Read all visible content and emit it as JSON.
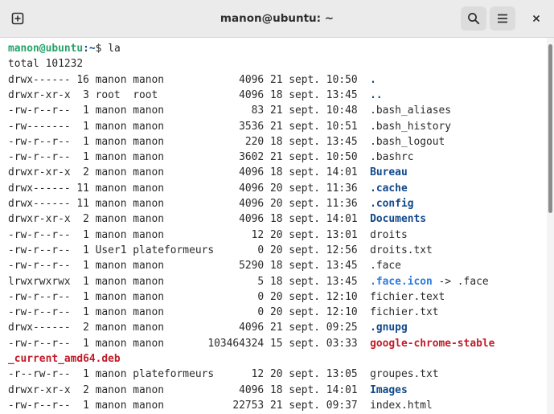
{
  "window": {
    "title": "manon@ubuntu: ~"
  },
  "toolbar": {
    "new_tab_icon": "new-tab-icon",
    "search_icon": "search-icon",
    "menu_icon": "hamburger-menu-icon",
    "close_icon": "close-icon"
  },
  "prompt": {
    "user_host": "manon@ubuntu",
    "path": ":~",
    "command": "$ la"
  },
  "output": {
    "total": "total 101232",
    "rows": [
      {
        "meta": "drwx------ 16 manon manon            4096 21 sept. 10:50  ",
        "name": ".",
        "kind": "dir",
        "suffix": ""
      },
      {
        "meta": "drwxr-xr-x  3 root  root             4096 18 sept. 13:45  ",
        "name": "..",
        "kind": "dir",
        "suffix": ""
      },
      {
        "meta": "-rw-r--r--  1 manon manon              83 21 sept. 10:48  ",
        "name": ".bash_aliases",
        "kind": "file",
        "suffix": ""
      },
      {
        "meta": "-rw-------  1 manon manon            3536 21 sept. 10:51  ",
        "name": ".bash_history",
        "kind": "file",
        "suffix": ""
      },
      {
        "meta": "-rw-r--r--  1 manon manon             220 18 sept. 13:45  ",
        "name": ".bash_logout",
        "kind": "file",
        "suffix": ""
      },
      {
        "meta": "-rw-r--r--  1 manon manon            3602 21 sept. 10:50  ",
        "name": ".bashrc",
        "kind": "file",
        "suffix": ""
      },
      {
        "meta": "drwxr-xr-x  2 manon manon            4096 18 sept. 14:01  ",
        "name": "Bureau",
        "kind": "dir",
        "suffix": ""
      },
      {
        "meta": "drwx------ 11 manon manon            4096 20 sept. 11:36  ",
        "name": ".cache",
        "kind": "dir",
        "suffix": ""
      },
      {
        "meta": "drwx------ 11 manon manon            4096 20 sept. 11:36  ",
        "name": ".config",
        "kind": "dir",
        "suffix": ""
      },
      {
        "meta": "drwxr-xr-x  2 manon manon            4096 18 sept. 14:01  ",
        "name": "Documents",
        "kind": "dir",
        "suffix": ""
      },
      {
        "meta": "-rw-r--r--  1 manon manon              12 20 sept. 13:01  ",
        "name": "droits",
        "kind": "file",
        "suffix": ""
      },
      {
        "meta": "-rw-r--r--  1 User1 plateformeurs       0 20 sept. 12:56  ",
        "name": "droits.txt",
        "kind": "file",
        "suffix": ""
      },
      {
        "meta": "-rw-r--r--  1 manon manon            5290 18 sept. 13:45  ",
        "name": ".face",
        "kind": "file",
        "suffix": ""
      },
      {
        "meta": "lrwxrwxrwx  1 manon manon               5 18 sept. 13:45  ",
        "name": ".face.icon",
        "kind": "link",
        "suffix": " -> .face"
      },
      {
        "meta": "-rw-r--r--  1 manon manon               0 20 sept. 12:10  ",
        "name": "fichier.text",
        "kind": "file",
        "suffix": ""
      },
      {
        "meta": "-rw-r--r--  1 manon manon               0 20 sept. 12:10  ",
        "name": "fichier.txt",
        "kind": "file",
        "suffix": ""
      },
      {
        "meta": "drwx------  2 manon manon            4096 21 sept. 09:25  ",
        "name": ".gnupg",
        "kind": "dir",
        "suffix": ""
      },
      {
        "meta": "-rw-r--r--  1 manon manon       103464324 15 sept. 03:33  ",
        "name": "google-chrome-stable",
        "kind": "pkg",
        "suffix": ""
      },
      {
        "meta": "",
        "name": "_current_amd64.deb",
        "kind": "pkg",
        "suffix": ""
      },
      {
        "meta": "-r--rw-r--  1 manon plateformeurs      12 20 sept. 13:05  ",
        "name": "groupes.txt",
        "kind": "file",
        "suffix": ""
      },
      {
        "meta": "drwxr-xr-x  2 manon manon            4096 18 sept. 14:01  ",
        "name": "Images",
        "kind": "dir",
        "suffix": ""
      },
      {
        "meta": "-rw-r--r--  1 manon manon           22753 21 sept. 09:37  ",
        "name": "index.html",
        "kind": "file",
        "suffix": ""
      }
    ]
  },
  "colors": {
    "prompt_user": "#26a269",
    "prompt_path": "#12488b",
    "directory": "#12488b",
    "symlink": "#2a7bde",
    "package": "#c01c28",
    "text": "#2a2a2a",
    "titlebar": "#ebebeb"
  }
}
